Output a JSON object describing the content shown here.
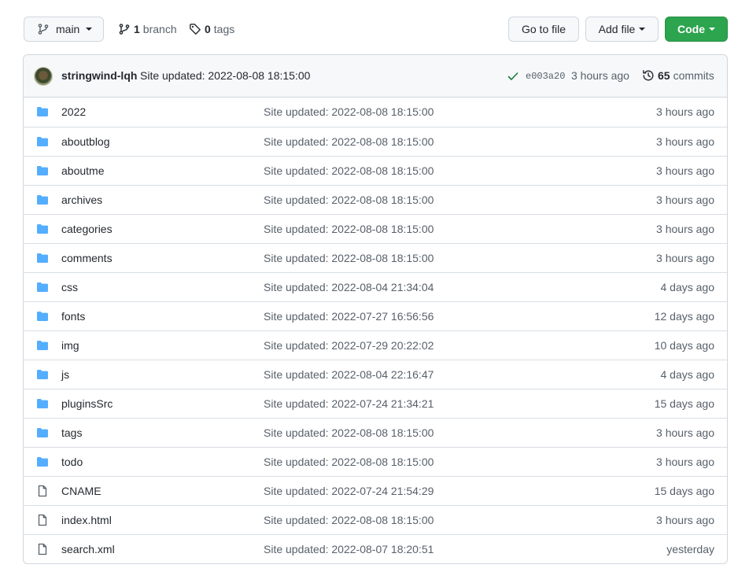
{
  "toolbar": {
    "branch_label": "main",
    "branch_count": "1",
    "branch_text": "branch",
    "tag_count": "0",
    "tag_text": "tags",
    "go_to_file": "Go to file",
    "add_file": "Add file",
    "code": "Code"
  },
  "commit": {
    "author": "stringwind-lqh",
    "message": "Site updated: 2022-08-08 18:15:00",
    "sha": "e003a20",
    "ago": "3 hours ago",
    "commit_count": "65",
    "commits_text": "commits"
  },
  "files": [
    {
      "name": "2022",
      "type": "folder",
      "message": "Site updated: 2022-08-08 18:15:00",
      "age": "3 hours ago"
    },
    {
      "name": "aboutblog",
      "type": "folder",
      "message": "Site updated: 2022-08-08 18:15:00",
      "age": "3 hours ago"
    },
    {
      "name": "aboutme",
      "type": "folder",
      "message": "Site updated: 2022-08-08 18:15:00",
      "age": "3 hours ago"
    },
    {
      "name": "archives",
      "type": "folder",
      "message": "Site updated: 2022-08-08 18:15:00",
      "age": "3 hours ago"
    },
    {
      "name": "categories",
      "type": "folder",
      "message": "Site updated: 2022-08-08 18:15:00",
      "age": "3 hours ago"
    },
    {
      "name": "comments",
      "type": "folder",
      "message": "Site updated: 2022-08-08 18:15:00",
      "age": "3 hours ago"
    },
    {
      "name": "css",
      "type": "folder",
      "message": "Site updated: 2022-08-04 21:34:04",
      "age": "4 days ago"
    },
    {
      "name": "fonts",
      "type": "folder",
      "message": "Site updated: 2022-07-27 16:56:56",
      "age": "12 days ago"
    },
    {
      "name": "img",
      "type": "folder",
      "message": "Site updated: 2022-07-29 20:22:02",
      "age": "10 days ago"
    },
    {
      "name": "js",
      "type": "folder",
      "message": "Site updated: 2022-08-04 22:16:47",
      "age": "4 days ago"
    },
    {
      "name": "pluginsSrc",
      "type": "folder",
      "message": "Site updated: 2022-07-24 21:34:21",
      "age": "15 days ago"
    },
    {
      "name": "tags",
      "type": "folder",
      "message": "Site updated: 2022-08-08 18:15:00",
      "age": "3 hours ago"
    },
    {
      "name": "todo",
      "type": "folder",
      "message": "Site updated: 2022-08-08 18:15:00",
      "age": "3 hours ago"
    },
    {
      "name": "CNAME",
      "type": "file",
      "message": "Site updated: 2022-07-24 21:54:29",
      "age": "15 days ago"
    },
    {
      "name": "index.html",
      "type": "file",
      "message": "Site updated: 2022-08-08 18:15:00",
      "age": "3 hours ago"
    },
    {
      "name": "search.xml",
      "type": "file",
      "message": "Site updated: 2022-08-07 18:20:51",
      "age": "yesterday"
    }
  ],
  "colors": {
    "folder": "#54aeff",
    "file_icon": "#57606a",
    "code_button": "#2da44e",
    "check": "#1a7f37"
  }
}
